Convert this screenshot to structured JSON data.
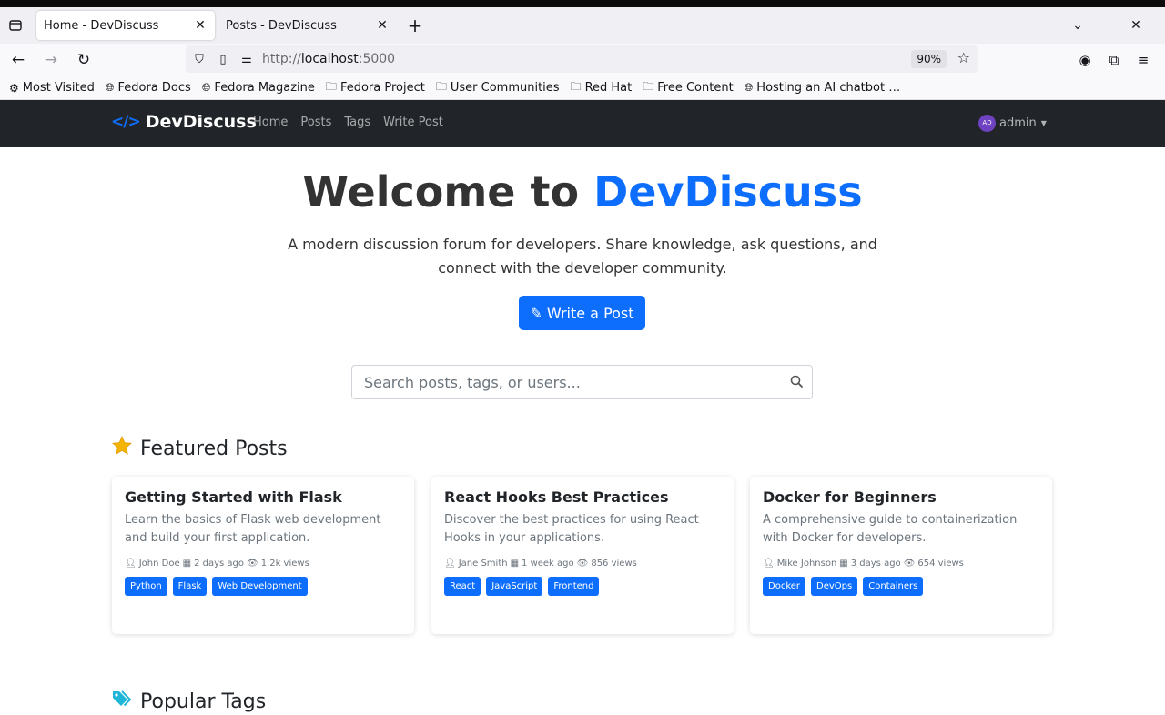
{
  "browser": {
    "tabs": [
      {
        "title": "Home - DevDiscuss",
        "active": true
      },
      {
        "title": "Posts - DevDiscuss",
        "active": false
      }
    ],
    "url_prefix": "http://",
    "url_host": "localhost",
    "url_port": ":5000",
    "zoom": "90%",
    "bookmarks": [
      {
        "label": "Most Visited",
        "icon": "gear-icon"
      },
      {
        "label": "Fedora Docs",
        "icon": "globe-icon"
      },
      {
        "label": "Fedora Magazine",
        "icon": "globe-icon"
      },
      {
        "label": "Fedora Project",
        "icon": "folder-icon"
      },
      {
        "label": "User Communities",
        "icon": "folder-icon"
      },
      {
        "label": "Red Hat",
        "icon": "folder-icon"
      },
      {
        "label": "Free Content",
        "icon": "folder-icon"
      },
      {
        "label": "Hosting an AI chatbot …",
        "icon": "globe-icon"
      }
    ]
  },
  "nav": {
    "brand": "DevDiscuss",
    "links": [
      "Home",
      "Posts",
      "Tags",
      "Write Post"
    ],
    "avatar_initials": "AD",
    "user": "admin"
  },
  "hero": {
    "title_prefix": "Welcome to",
    "title_accent": "DevDiscuss",
    "subtitle": "A modern discussion forum for developers. Share knowledge, ask questions, and connect with the developer community.",
    "button": "Write a Post"
  },
  "search": {
    "placeholder": "Search posts, tags, or users..."
  },
  "featured": {
    "title": "Featured Posts",
    "posts": [
      {
        "title": "Getting Started with Flask",
        "excerpt": "Learn the basics of Flask web development and build your first application.",
        "author": "John Doe",
        "date": "2 days ago",
        "views": "1.2k views",
        "tags": [
          "Python",
          "Flask",
          "Web Development"
        ]
      },
      {
        "title": "React Hooks Best Practices",
        "excerpt": "Discover the best practices for using React Hooks in your applications.",
        "author": "Jane Smith",
        "date": "1 week ago",
        "views": "856 views",
        "tags": [
          "React",
          "JavaScript",
          "Frontend"
        ]
      },
      {
        "title": "Docker for Beginners",
        "excerpt": "A comprehensive guide to containerization with Docker for developers.",
        "author": "Mike Johnson",
        "date": "3 days ago",
        "views": "654 views",
        "tags": [
          "Docker",
          "DevOps",
          "Containers"
        ]
      }
    ]
  },
  "popular": {
    "title": "Popular Tags"
  },
  "colors": {
    "accent": "#0d6efd",
    "navbar": "#212529",
    "avatar": "#6f42c1"
  }
}
